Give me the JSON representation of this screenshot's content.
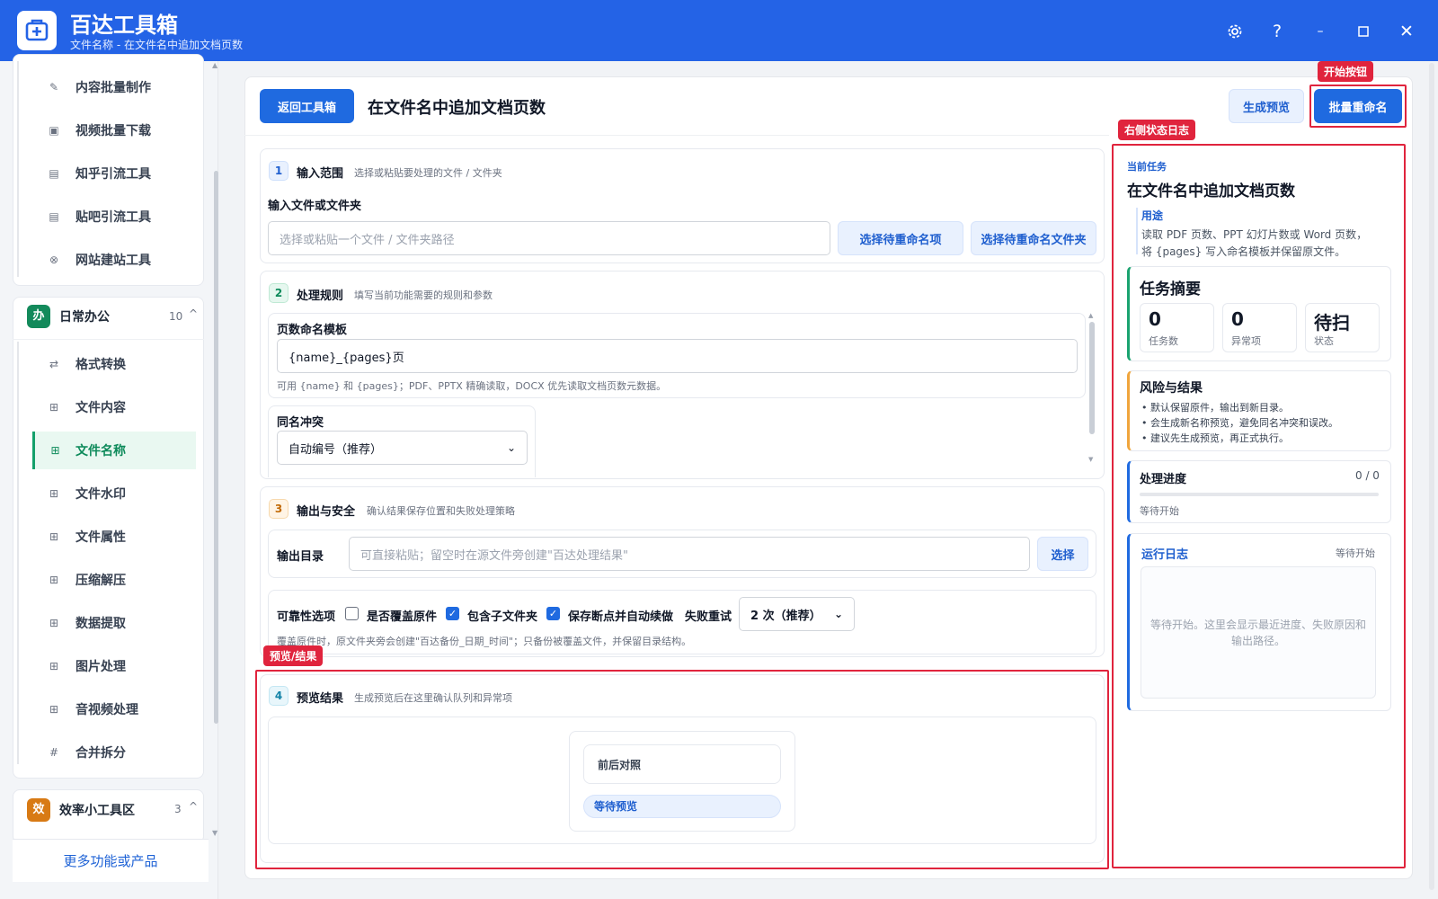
{
  "app": {
    "title": "百达工具箱",
    "subtitle": "文件名称 - 在文件名中追加文档页数"
  },
  "sidebar": {
    "top_items": [
      {
        "label": "内容批量制作",
        "icon": "✎"
      },
      {
        "label": "视频批量下载",
        "icon": "▣"
      },
      {
        "label": "知乎引流工具",
        "icon": "▤"
      },
      {
        "label": "贴吧引流工具",
        "icon": "▤"
      },
      {
        "label": "网站建站工具",
        "icon": "⊗"
      }
    ],
    "group_daily": {
      "badge": "办",
      "title": "日常办公",
      "count": "10",
      "chevron": "^"
    },
    "daily_items": [
      {
        "label": "格式转换",
        "icon": "⇄"
      },
      {
        "label": "文件内容",
        "icon": "⊞"
      },
      {
        "label": "文件名称",
        "icon": "⊞"
      },
      {
        "label": "文件水印",
        "icon": "⊞"
      },
      {
        "label": "文件属性",
        "icon": "⊞"
      },
      {
        "label": "压缩解压",
        "icon": "⊞"
      },
      {
        "label": "数据提取",
        "icon": "⊞"
      },
      {
        "label": "图片处理",
        "icon": "⊞"
      },
      {
        "label": "音视频处理",
        "icon": "⊞"
      },
      {
        "label": "合并拆分",
        "icon": "#"
      }
    ],
    "active_item": "文件名称",
    "group_efficiency": {
      "badge": "效",
      "title": "效率小工具区",
      "count": "3",
      "chevron": "^"
    },
    "more_link": "更多功能或产品"
  },
  "header": {
    "back_button": "返回工具箱",
    "page_title": "在文件名中追加文档页数",
    "preview_button": "生成预览",
    "run_button": "批量重命名"
  },
  "section1": {
    "num": "1",
    "title": "输入范围",
    "desc": "选择或粘贴要处理的文件 / 文件夹",
    "field_label": "输入文件或文件夹",
    "input_placeholder": "选择或粘贴一个文件 / 文件夹路径",
    "btn_files": "选择待重命名项",
    "btn_folder": "选择待重命名文件夹"
  },
  "section2": {
    "num": "2",
    "title": "处理规则",
    "desc": "填写当前功能需要的规则和参数",
    "template_label": "页数命名模板",
    "template_value": "{name}_{pages}页",
    "template_hint": "可用 {name} 和 {pages}；PDF、PPTX 精确读取，DOCX 优先读取文档页数元数据。",
    "conflict_label": "同名冲突",
    "conflict_value": "自动编号（推荐）"
  },
  "section3": {
    "num": "3",
    "title": "输出与安全",
    "desc": "确认结果保存位置和失败处理策略",
    "output_label": "输出目录",
    "output_placeholder": "可直接粘贴；留空时在源文件旁创建\"百达处理结果\"",
    "choose_button": "选择",
    "reliability_label": "可靠性选项",
    "opt_overwrite": "是否覆盖原件",
    "opt_subfolders": "包含子文件夹",
    "opt_resume": "保存断点并自动续做",
    "retry_label": "失败重试",
    "retry_value": "2 次（推荐）",
    "hint": "覆盖原件时，原文件夹旁会创建\"百达备份_日期_时间\"；只备份被覆盖文件，并保留目录结构。"
  },
  "section4": {
    "num": "4",
    "title": "预览结果",
    "desc": "生成预览后在这里确认队列和异常项",
    "compare_label": "前后对照",
    "status_pill": "等待预览"
  },
  "annotations": {
    "start_button": "开始按钮",
    "right_log": "右侧状态日志",
    "preview_result": "预览/结果"
  },
  "right_panel": {
    "task_label": "当前任务",
    "task_title": "在文件名中追加文档页数",
    "purpose_label": "用途",
    "purpose_text_1": "读取 PDF 页数、PPT 幻灯片数或 Word 页数，",
    "purpose_text_2": "将 {pages} 写入命名模板并保留原文件。",
    "summary_title": "任务摘要",
    "stats": [
      {
        "value": "0",
        "label": "任务数"
      },
      {
        "value": "0",
        "label": "异常项"
      },
      {
        "value": "待扫",
        "label": "状态"
      }
    ],
    "risk_title": "风险与结果",
    "risk_items": [
      "默认保留原件，输出到新目录。",
      "会生成新名称预览，避免同名冲突和误改。",
      "建议先生成预览，再正式执行。"
    ],
    "progress_title": "处理进度",
    "progress_count": "0 / 0",
    "progress_value": 0,
    "progress_status": "等待开始",
    "log_title": "运行日志",
    "log_status": "等待开始",
    "log_text_1": "等待开始。这里会显示最近进度、失败原因和",
    "log_text_2": "输出路径。"
  },
  "colors": {
    "brand": "#2463e6",
    "primary_button": "#1f6ae0",
    "active_green": "#14a06b",
    "annotation_red": "#e0243d",
    "risk_accent": "#f0a53c",
    "summary_accent": "#1aa36f"
  }
}
